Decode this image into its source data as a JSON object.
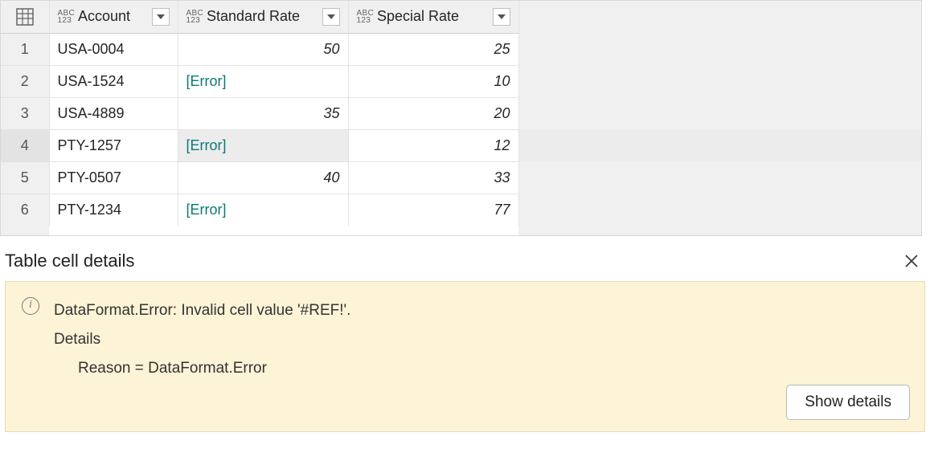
{
  "table": {
    "columns": [
      {
        "label": "Account",
        "type_top": "ABC",
        "type_bottom": "123"
      },
      {
        "label": "Standard Rate",
        "type_top": "ABC",
        "type_bottom": "123"
      },
      {
        "label": "Special Rate",
        "type_top": "ABC",
        "type_bottom": "123"
      }
    ],
    "rows": [
      {
        "num": "1",
        "account": "USA-0004",
        "std": "50",
        "std_is_error": false,
        "spec": "25"
      },
      {
        "num": "2",
        "account": "USA-1524",
        "std": "[Error]",
        "std_is_error": true,
        "spec": "10"
      },
      {
        "num": "3",
        "account": "USA-4889",
        "std": "35",
        "std_is_error": false,
        "spec": "20"
      },
      {
        "num": "4",
        "account": "PTY-1257",
        "std": "[Error]",
        "std_is_error": true,
        "spec": "12",
        "selected": true
      },
      {
        "num": "5",
        "account": "PTY-0507",
        "std": "40",
        "std_is_error": false,
        "spec": "33"
      },
      {
        "num": "6",
        "account": "PTY-1234",
        "std": "[Error]",
        "std_is_error": true,
        "spec": "77"
      }
    ]
  },
  "details": {
    "title": "Table cell details",
    "error_line": "DataFormat.Error: Invalid cell value '#REF!'.",
    "details_label": "Details",
    "reason_line": "Reason = DataFormat.Error",
    "show_button": "Show details"
  }
}
